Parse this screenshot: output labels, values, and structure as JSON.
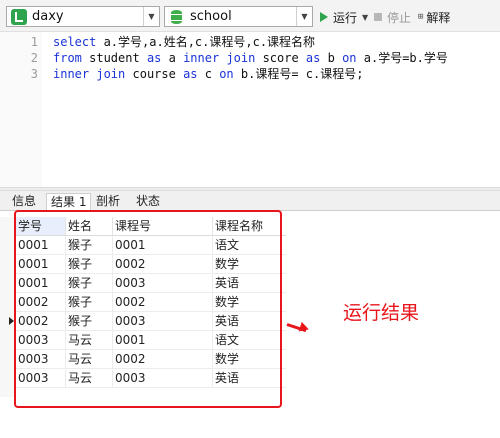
{
  "toolbar": {
    "connection": "daxy",
    "database": "school",
    "run_label": "运行",
    "stop_label": "停止",
    "explain_label": "解释"
  },
  "editor": {
    "lines": [
      {
        "num": "1",
        "text": "select a.学号,a.姓名,c.课程号,c.课程名称"
      },
      {
        "num": "2",
        "text": "from student as a inner join score as b on a.学号=b.学号"
      },
      {
        "num": "3",
        "text": "inner join course as c on b.课程号= c.课程号;"
      }
    ]
  },
  "tabs": [
    "信息",
    "结果 1",
    "剖析",
    "状态"
  ],
  "active_tab": "结果 1",
  "result": {
    "columns": [
      "学号",
      "姓名",
      "课程号",
      "课程名称"
    ],
    "rows": [
      [
        "0001",
        "猴子",
        "0001",
        "语文"
      ],
      [
        "0001",
        "猴子",
        "0002",
        "数学"
      ],
      [
        "0001",
        "猴子",
        "0003",
        "英语"
      ],
      [
        "0002",
        "猴子",
        "0002",
        "数学"
      ],
      [
        "0002",
        "猴子",
        "0003",
        "英语"
      ],
      [
        "0003",
        "马云",
        "0001",
        "语文"
      ],
      [
        "0003",
        "马云",
        "0002",
        "数学"
      ],
      [
        "0003",
        "马云",
        "0003",
        "英语"
      ]
    ],
    "current_row": 4
  },
  "annotation": {
    "text": "运行结果",
    "color": "#e8151b"
  },
  "colors": {
    "keyword": "#1a33d6",
    "run_icon": "#2ea44f"
  }
}
